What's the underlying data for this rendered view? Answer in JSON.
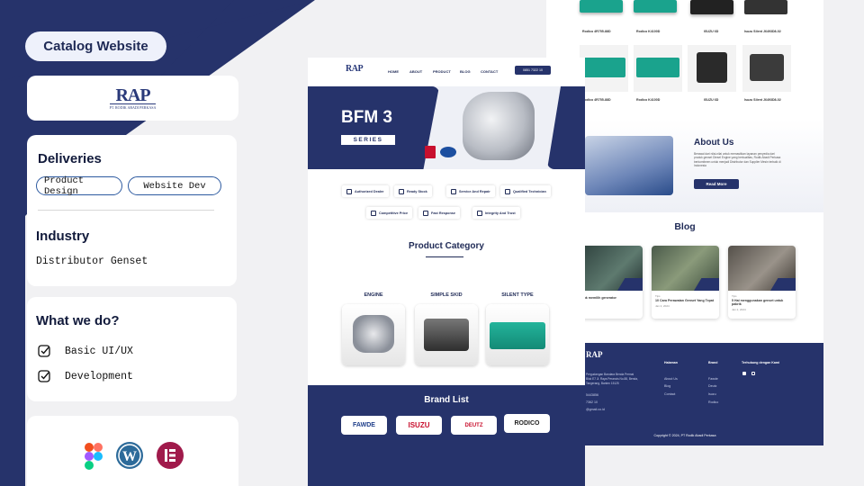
{
  "left_panel": {
    "title": "Catalog Website",
    "logo": {
      "mark": "RAP",
      "name": "PT. RODIK ABADI PERKASA"
    },
    "deliveries": {
      "heading": "Deliveries",
      "chips": [
        "Product Design",
        "Website Dev"
      ]
    },
    "industry": {
      "heading": "Industry",
      "value": "Distributor Genset"
    },
    "what_we_do": {
      "heading": "What we do?",
      "items": [
        "Basic UI/UX",
        "Development"
      ]
    },
    "tools": [
      "figma-icon",
      "wordpress-icon",
      "elementor-icon"
    ]
  },
  "site": {
    "nav": {
      "logo": "RAP",
      "links": [
        "HOME",
        "ABOUT",
        "PRODUCT",
        "BLOG",
        "CONTACT"
      ],
      "phone_button": "0851 7322 10"
    },
    "hero": {
      "title": "BFM 3",
      "subtitle": "SERIES"
    },
    "features": [
      "Authorized Dealer",
      "Ready Stock",
      "Service And Repair",
      "Qualified Technician",
      "Competitive Price",
      "Fast Response",
      "Integrity And Trust"
    ],
    "product_category": {
      "heading": "Product Category",
      "items": [
        "ENGINE",
        "SIMPLE SKID",
        "SILENT TYPE"
      ]
    },
    "brand_list": {
      "heading": "Brand List",
      "brands": [
        "FAWDE",
        "ISUZU",
        "DEUTZ",
        "RODICO"
      ]
    },
    "products_row1": [
      "Rodico 4R755-88D",
      "Rodico K4100D",
      "ISUZU 6D",
      "Isuzu Silent J6493D8-02"
    ],
    "products_row2": [
      "Rodico 4R755-88D",
      "Rodico K4100D",
      "ISUZU 6D",
      "Isuzu Silent J6493D8-02"
    ],
    "about": {
      "heading": "About Us",
      "body": "Berawal dari nilai-nilai untuk memastikan layanan penyedia dari produk genset Diesel Engine yang berkualitas, Rodik Abadi Perkasa berkomitmen untuk menjadi Distributor dan Supplier Mesin terbaik di Indonesia",
      "button": "Read More"
    },
    "blog": {
      "heading": "Blog",
      "posts": [
        {
          "tag": "",
          "title": "untuk memilih generator",
          "date": ""
        },
        {
          "tag": "Tips",
          "title": "10 Cara Perawatan Genset Yang Tepat",
          "date": "Jan 2, 2024"
        },
        {
          "tag": "Tips",
          "title": "5 Hal menggunakan genset untuk pabrik",
          "date": "Jan 2, 2024"
        }
      ]
    },
    "footer": {
      "address": "Pergudangan Bandara Benda Permai Blok E7 Jl. Raya Perancis No.88, Benda, Tangerang, Banten 15125",
      "phone": "5443856",
      "wa": "7362 10",
      "email": "@gmail.co.id",
      "col_halaman": {
        "heading": "Halaman",
        "items": [
          "About Us",
          "Blog",
          "Contact"
        ]
      },
      "col_brand": {
        "heading": "Brand",
        "items": [
          "Fawde",
          "Deutz",
          "Isuzu",
          "Rodico"
        ]
      },
      "col_social": {
        "heading": "Terhubung dengan Kami"
      },
      "copyright": "Copyright © 2024, PT Rodik Abadi Perkasa"
    }
  },
  "colors": {
    "navy": "#26336b",
    "teal_genset": "#1aa38d",
    "white": "#ffffff"
  }
}
